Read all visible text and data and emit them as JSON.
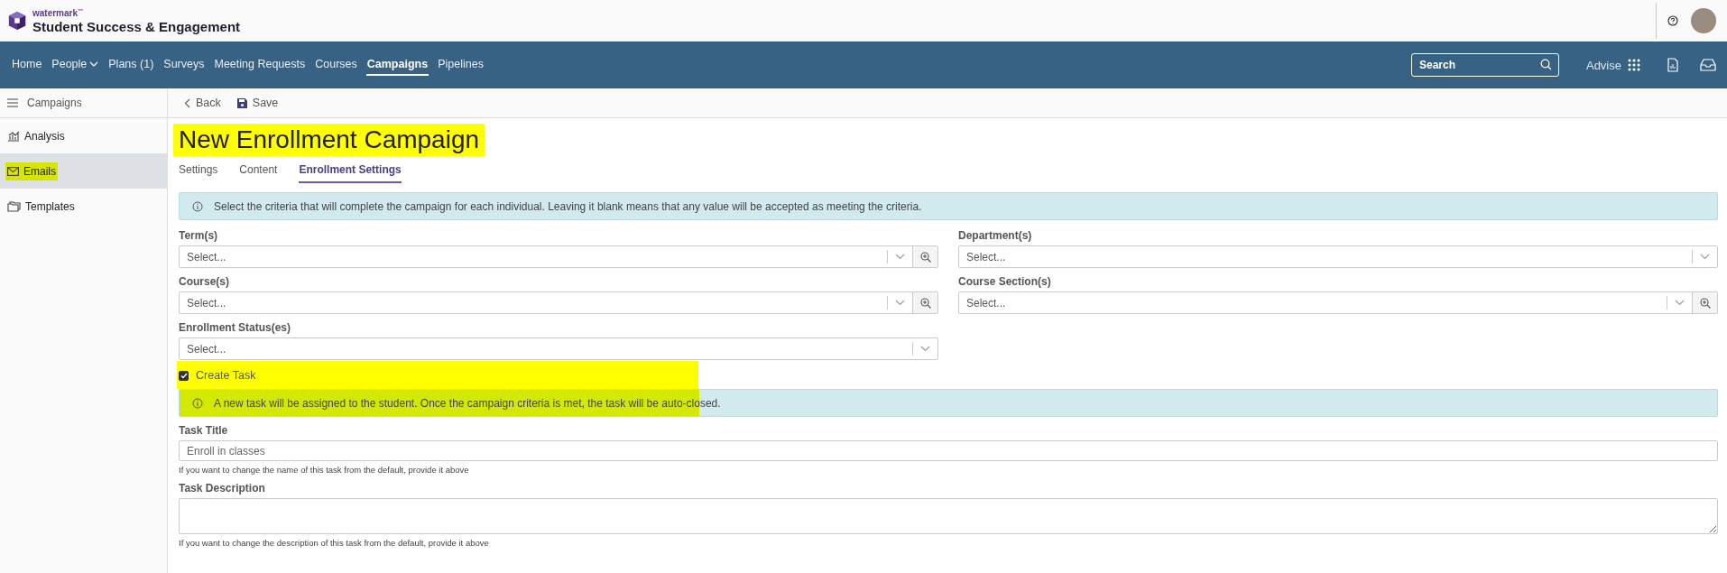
{
  "header": {
    "brand": "watermark",
    "trademark": "™",
    "product": "Student Success & Engagement"
  },
  "nav": {
    "items": [
      {
        "label": "Home",
        "selected": false,
        "dropdown": false
      },
      {
        "label": "People",
        "selected": false,
        "dropdown": true
      },
      {
        "label": "Plans (1)",
        "selected": false,
        "dropdown": false
      },
      {
        "label": "Surveys",
        "selected": false,
        "dropdown": false
      },
      {
        "label": "Meeting Requests",
        "selected": false,
        "dropdown": false
      },
      {
        "label": "Courses",
        "selected": false,
        "dropdown": false
      },
      {
        "label": "Campaigns",
        "selected": true,
        "dropdown": false
      },
      {
        "label": "Pipelines",
        "selected": false,
        "dropdown": false
      }
    ],
    "search": {
      "placeholder": "Search"
    },
    "advise": "Advise"
  },
  "sidebar": {
    "title": "Campaigns",
    "items": [
      {
        "label": "Analysis",
        "kind": "chart",
        "selected": false,
        "highlighted": false
      },
      {
        "label": "Emails",
        "kind": "mail",
        "selected": true,
        "highlighted": true
      },
      {
        "label": "Templates",
        "kind": "folder",
        "selected": false,
        "highlighted": false
      }
    ]
  },
  "toolbar": {
    "back": "Back",
    "save": "Save"
  },
  "title": {
    "text": "New Enrollment Campaign",
    "highlighted": true
  },
  "tabs": [
    {
      "label": "Settings",
      "selected": false
    },
    {
      "label": "Content",
      "selected": false
    },
    {
      "label": "Enrollment Settings",
      "selected": true
    }
  ],
  "criteria_info": "Select the criteria that will complete the campaign for each individual. Leaving it blank means that any value will be accepted as meeting the criteria.",
  "fields": [
    {
      "label": "Term(s)",
      "placeholder": "Select...",
      "lookup": true
    },
    {
      "label": "Department(s)",
      "placeholder": "Select...",
      "lookup": false
    },
    {
      "label": "Course(s)",
      "placeholder": "Select...",
      "lookup": true
    },
    {
      "label": "Course Section(s)",
      "placeholder": "Select...",
      "lookup": true
    },
    {
      "label": "Enrollment Status(es)",
      "placeholder": "Select...",
      "lookup": false
    }
  ],
  "create_task": {
    "label": "Create Task",
    "checked": true,
    "highlighted": true,
    "info": "A new task will be assigned to the student. Once the campaign criteria is met, the task will be auto-closed."
  },
  "task_title": {
    "label": "Task Title",
    "value": "Enroll in classes",
    "help": "If you want to change the name of this task from the default, provide it above"
  },
  "task_description": {
    "label": "Task Description",
    "help": "If you want to change the description of this task from the default, provide it above"
  }
}
